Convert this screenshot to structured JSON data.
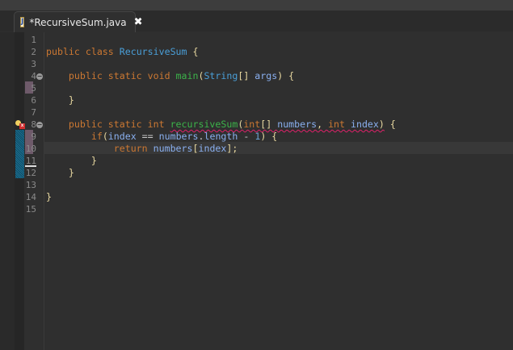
{
  "tab": {
    "title": "*RecursiveSum.java",
    "icon": "java-file-icon",
    "close": "✖"
  },
  "colors": {
    "kw": "#cc7832",
    "cls": "#4a9fd8",
    "method": "#3cb34a",
    "var": "#8ab0f0",
    "punct": "#e8d8a0",
    "num": "#6aa0d0",
    "plain": "#c8c8c8"
  },
  "line_numbers": [
    "1",
    "2",
    "3",
    "4",
    "5",
    "6",
    "7",
    "8",
    "9",
    "10",
    "11",
    "12",
    "13",
    "14",
    "15"
  ],
  "lines": [
    [],
    [
      {
        "t": "public class ",
        "c": "kw"
      },
      {
        "t": "RecursiveSum",
        "c": "cls"
      },
      {
        "t": " {",
        "c": "punct"
      }
    ],
    [],
    [
      {
        "t": "    public static void ",
        "c": "kw"
      },
      {
        "t": "main",
        "c": "method"
      },
      {
        "t": "(",
        "c": "punct"
      },
      {
        "t": "String",
        "c": "cls"
      },
      {
        "t": "[] ",
        "c": "punct"
      },
      {
        "t": "args",
        "c": "var"
      },
      {
        "t": ") {",
        "c": "punct"
      }
    ],
    [],
    [
      {
        "t": "    }",
        "c": "punct"
      }
    ],
    [],
    [
      {
        "t": "    public static int ",
        "c": "kw"
      },
      {
        "t": "recursiveSum",
        "c": "method",
        "sq": 1
      },
      {
        "t": "(",
        "c": "punct",
        "sq": 1
      },
      {
        "t": "int",
        "c": "kw",
        "sq": 1
      },
      {
        "t": "[] ",
        "c": "punct",
        "sq": 1
      },
      {
        "t": "numbers",
        "c": "var",
        "sq": 1
      },
      {
        "t": ", ",
        "c": "punct",
        "sq": 1
      },
      {
        "t": "int ",
        "c": "kw",
        "sq": 1
      },
      {
        "t": "index",
        "c": "var",
        "sq": 1
      },
      {
        "t": ")",
        "c": "punct",
        "sq": 1
      },
      {
        "t": " {",
        "c": "punct"
      }
    ],
    [
      {
        "t": "        if",
        "c": "kw"
      },
      {
        "t": "(",
        "c": "punct"
      },
      {
        "t": "index",
        "c": "var"
      },
      {
        "t": " == ",
        "c": "plain"
      },
      {
        "t": "numbers",
        "c": "var"
      },
      {
        "t": ".",
        "c": "plain"
      },
      {
        "t": "length",
        "c": "var"
      },
      {
        "t": " - ",
        "c": "plain"
      },
      {
        "t": "1",
        "c": "num"
      },
      {
        "t": ") {",
        "c": "punct"
      }
    ],
    [
      {
        "t": "            return ",
        "c": "kw"
      },
      {
        "t": "numbers",
        "c": "var"
      },
      {
        "t": "[",
        "c": "punct"
      },
      {
        "t": "index",
        "c": "var"
      },
      {
        "t": "];",
        "c": "punct"
      }
    ],
    [
      {
        "t": "        }",
        "c": "punct"
      }
    ],
    [
      {
        "t": "    }",
        "c": "punct"
      }
    ],
    [],
    [
      {
        "t": "}",
        "c": "punct"
      }
    ],
    []
  ]
}
